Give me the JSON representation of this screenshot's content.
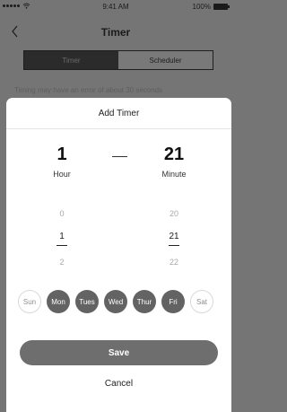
{
  "status_bar": {
    "time": "9:41 AM",
    "battery": "100%"
  },
  "header": {
    "title": "Timer"
  },
  "tabs": [
    {
      "label": "Timer",
      "active": true
    },
    {
      "label": "Scheduler",
      "active": false
    }
  ],
  "hint": "Timing may have an error of about 30 seconds",
  "sheet": {
    "title": "Add Timer",
    "hour": {
      "value": "1",
      "unit": "Hour",
      "options": [
        "0",
        "1",
        "2"
      ]
    },
    "minute": {
      "value": "21",
      "unit": "Minute",
      "options": [
        "20",
        "21",
        "22"
      ]
    },
    "days": [
      {
        "label": "Sun",
        "selected": false
      },
      {
        "label": "Mon",
        "selected": true
      },
      {
        "label": "Tues",
        "selected": true
      },
      {
        "label": "Wed",
        "selected": true
      },
      {
        "label": "Thur",
        "selected": true
      },
      {
        "label": "Fri",
        "selected": true
      },
      {
        "label": "Sat",
        "selected": false
      }
    ],
    "save_label": "Save",
    "cancel_label": "Cancel"
  },
  "colors": {
    "selected_day": "#636363",
    "save_button": "#6e6e6e",
    "overlay": "#757575"
  }
}
